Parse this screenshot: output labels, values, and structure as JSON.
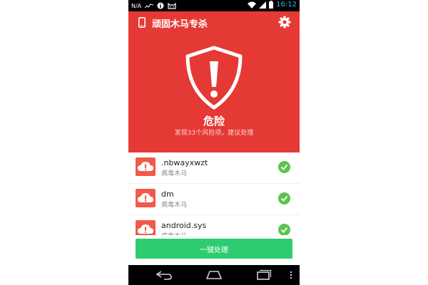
{
  "status_bar": {
    "carrier": "N/A",
    "time": "16:12"
  },
  "header": {
    "title": "顽固木马专杀"
  },
  "hero": {
    "status_title": "危险",
    "status_subtitle": "发现33个风险项，建议处理"
  },
  "items": [
    {
      "name": ".nbwayxwzt",
      "type": "病毒木马"
    },
    {
      "name": "dm",
      "type": "病毒木马"
    },
    {
      "name": "android.sys",
      "type": "病毒木马"
    }
  ],
  "action": {
    "label": "一键处理"
  },
  "colors": {
    "danger": "#e53935",
    "success": "#2ecc71",
    "check": "#5cc34f"
  }
}
